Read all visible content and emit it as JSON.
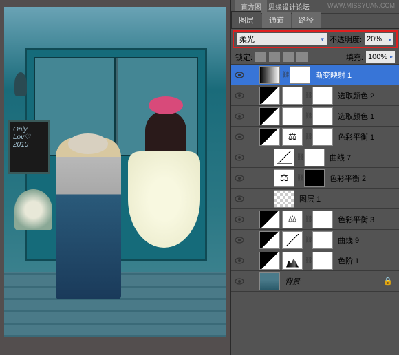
{
  "watermark": "WWW.MISSYUAN.COM",
  "topbar": {
    "histogram": "直方图",
    "forum": "思缘设计论坛"
  },
  "tabs": {
    "layers": "图层",
    "channels": "通道",
    "paths": "路径"
  },
  "opts": {
    "blend_mode": "柔光",
    "opacity_label": "不透明度:",
    "opacity_value": "20%",
    "lock_label": "锁定:",
    "fill_label": "填充:",
    "fill_value": "100%"
  },
  "board": "Only\nLov♡\n2010",
  "layers": [
    {
      "name": "渐变映射 1",
      "type": "grad",
      "mask": "white",
      "selected": true,
      "indent": 0
    },
    {
      "name": "选取颜色 2",
      "type": "sel",
      "mask": "white",
      "indent": 0,
      "inv": true
    },
    {
      "name": "选取颜色 1",
      "type": "sel",
      "mask": "white",
      "indent": 0,
      "inv": true
    },
    {
      "name": "色彩平衡 1",
      "type": "bal",
      "mask": "white",
      "indent": 0,
      "inv": true
    },
    {
      "name": "曲线 7",
      "type": "curv",
      "mask": "white",
      "indent": 1
    },
    {
      "name": "色彩平衡 2",
      "type": "bal",
      "mask": "black",
      "indent": 1
    },
    {
      "name": "图层 1",
      "type": "checker",
      "mask": "none",
      "indent": 1
    },
    {
      "name": "色彩平衡 3",
      "type": "bal",
      "mask": "white",
      "indent": 0,
      "inv": true
    },
    {
      "name": "曲线 9",
      "type": "curv",
      "mask": "white",
      "indent": 0,
      "inv": true
    },
    {
      "name": "色阶 1",
      "type": "lev",
      "mask": "white",
      "indent": 0,
      "inv": true
    },
    {
      "name": "背景",
      "type": "img",
      "mask": "none",
      "indent": 0,
      "locked": true,
      "italic": true
    }
  ]
}
